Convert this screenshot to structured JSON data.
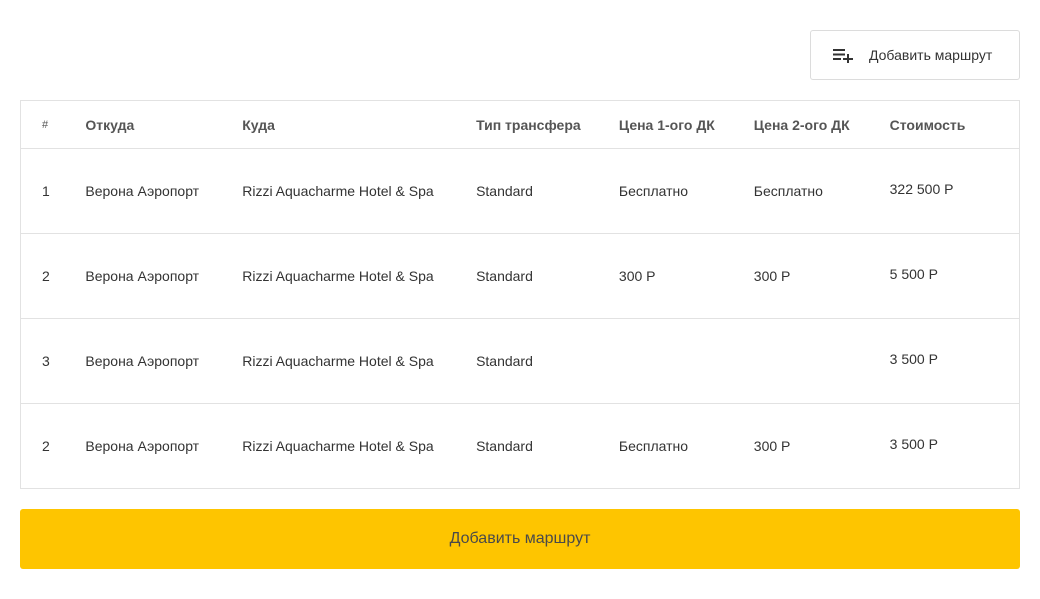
{
  "toolbar": {
    "add_route_label": "Добавить маршрут"
  },
  "table": {
    "headers": [
      "#",
      "Откуда",
      "Куда",
      "Тип трансфера",
      "Цена 1-ого ДК",
      "Цена 2-ого ДК",
      "Стоимость"
    ],
    "rows": [
      [
        "1",
        "Верона Аэропорт",
        "Rizzi Aquacharme Hotel & Spa",
        "Standard",
        "Бесплатно",
        "Бесплатно",
        "322 500 Р"
      ],
      [
        "2",
        "Верона Аэропорт",
        "Rizzi Aquacharme Hotel & Spa",
        "Standard",
        "300 Р",
        "300 Р",
        "5 500 Р"
      ],
      [
        "3",
        "Верона Аэропорт",
        "Rizzi Aquacharme Hotel & Spa",
        "Standard",
        "",
        "",
        "3 500 Р"
      ],
      [
        "2",
        "Верона Аэропорт",
        "Rizzi Aquacharme Hotel & Spa",
        "Standard",
        "Бесплатно",
        "300 Р",
        "3 500 Р"
      ]
    ]
  },
  "footer": {
    "add_route_label": "Добавить маршрут"
  },
  "colors": {
    "accent": "#fec500",
    "border": "#e2e2e2"
  },
  "icons": {
    "add_route": "playlist-add-icon"
  }
}
